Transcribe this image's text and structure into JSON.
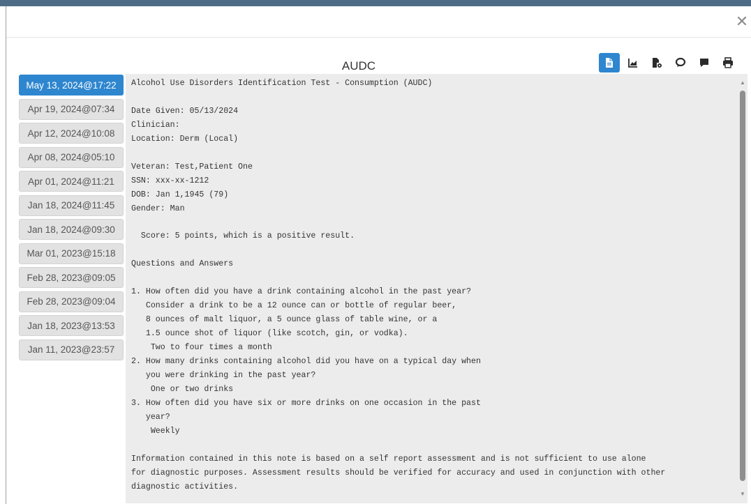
{
  "modal": {
    "title": "AUDC",
    "close_glyph": "✕"
  },
  "toolbar": [
    {
      "icon": "document-icon",
      "active": true
    },
    {
      "icon": "line-chart-icon",
      "active": false
    },
    {
      "icon": "file-settings-icon",
      "active": false
    },
    {
      "icon": "chat-bubble-icon",
      "active": false
    },
    {
      "icon": "comment-icon",
      "active": false
    },
    {
      "icon": "print-icon",
      "active": false
    }
  ],
  "dates": [
    "May 13, 2024@17:22",
    "Apr 19, 2024@07:34",
    "Apr 12, 2024@10:08",
    "Apr 08, 2024@05:10",
    "Apr 01, 2024@11:21",
    "Jan 18, 2024@11:45",
    "Jan 18, 2024@09:30",
    "Mar 01, 2023@15:18",
    "Feb 28, 2023@09:05",
    "Feb 28, 2023@09:04",
    "Jan 18, 2023@13:53",
    "Jan 11, 2023@23:57"
  ],
  "selected_date_index": 0,
  "note": {
    "text": "Alcohol Use Disorders Identification Test - Consumption (AUDC)\n\nDate Given: 05/13/2024\nClinician:\nLocation: Derm (Local)\n\nVeteran: Test,Patient One\nSSN: xxx-xx-1212\nDOB: Jan 1,1945 (79)\nGender: Man\n\n  Score: 5 points, which is a positive result.\n\nQuestions and Answers\n\n1. How often did you have a drink containing alcohol in the past year?\n   Consider a drink to be a 12 ounce can or bottle of regular beer,\n   8 ounces of malt liquor, a 5 ounce glass of table wine, or a\n   1.5 ounce shot of liquor (like scotch, gin, or vodka).\n    Two to four times a month\n2. How many drinks containing alcohol did you have on a typical day when\n   you were drinking in the past year?\n    One or two drinks\n3. How often did you have six or more drinks on one occasion in the past\n   year?\n    Weekly\n\nInformation contained in this note is based on a self report assessment and is not sufficient to use alone\nfor diagnostic purposes. Assessment results should be verified for accuracy and used in conjunction with other\ndiagnostic activities."
  },
  "colors": {
    "accent": "#2e86cf",
    "date_inactive_bg": "#e2e2e2",
    "note_bg": "#ececec"
  }
}
